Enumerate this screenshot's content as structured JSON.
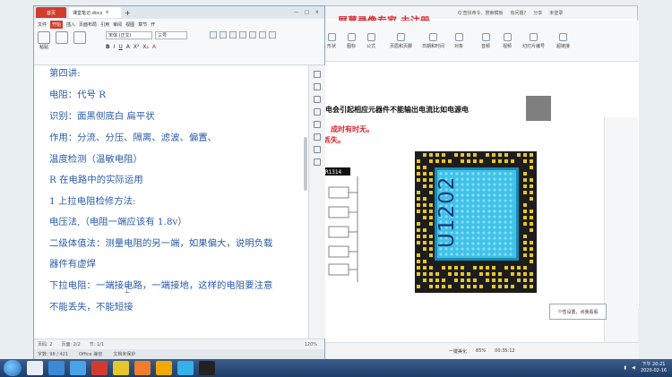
{
  "left_window": {
    "tabs": {
      "home": "首页",
      "doc": "课堂笔记.docx"
    },
    "menu": [
      "文件",
      "开始",
      "插入",
      "页面布局",
      "引用",
      "审阅",
      "视图",
      "章节",
      "开"
    ],
    "active_menu": "开始",
    "font": {
      "name": "宋体 (正文)",
      "size": "三号"
    },
    "paste_label": "粘贴",
    "format_buttons": [
      "B",
      "I",
      "U",
      "A",
      "X²",
      "X₂",
      "A"
    ],
    "document_lines": [
      "第四讲:",
      "电阻：代号 R",
      "识别：面黑侧底白  扁平状",
      "作用：分流、分压、隔离、滤波、偏置、",
      "温度检测（温敏电阻）",
      "R 在电路中的实际运用",
      "1  上拉电阻检修方法:",
      "电压法,（电阻一端应该有 1.8v）",
      "二级体值法：测量电阻的另一端，如果偏大，说明负载",
      "器件有虚焊",
      "下拉电阻：一端接电路，一端接地，这样的电阻要注意",
      "不能丢失，不能短接"
    ],
    "status": {
      "page": "页码: 2",
      "pages": "页面: 2/2",
      "section": "节: 1/1",
      "zoom": "120%"
    },
    "footer": {
      "words": "字数: 98 / 421",
      "compat": "Office 兼容",
      "protect": "文档未保护"
    }
  },
  "right_window": {
    "promo": "屏幕录像专家  未注册",
    "topbar": [
      "Q 查找命令、搜索模板",
      "有问题?",
      "分享",
      "未登录"
    ],
    "ribbon": [
      "形状",
      "图标",
      "公式",
      "页眉和页脚",
      "日期和时间",
      "对象",
      "音频",
      "视频",
      "幻灯片编号",
      "超链接"
    ],
    "slide": {
      "line1": "电会引起相应元器件不能输出电流比如电源电",
      "line2": "成时有时无。",
      "line3": "丢失。",
      "chip_label": "U1202",
      "schematic_label": "R1314"
    },
    "tip": "个性设置，点我看看",
    "bottom": {
      "zoom": "85%",
      "time": "00:35:12",
      "notes": "一键美化"
    }
  },
  "taskbar": {
    "time": "下午 20:21",
    "date": "2020-02-16"
  },
  "colors": {
    "accent_red": "#d23c2d",
    "doc_text": "#2a5ca8",
    "chip_blue": "#3ec2ea",
    "chip_label": "#15397a",
    "pcb_pads": "#e6c62a"
  }
}
